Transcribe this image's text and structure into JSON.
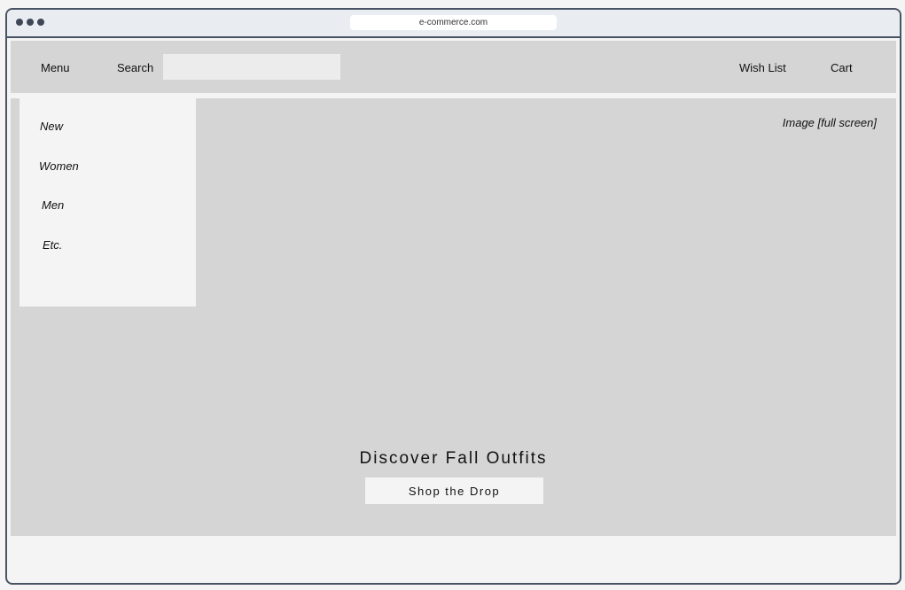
{
  "browser": {
    "url": "e-commerce.com"
  },
  "navbar": {
    "menu_label": "Menu",
    "search_label": "Search",
    "search_value": "",
    "wishlist_label": "Wish List",
    "cart_label": "Cart"
  },
  "menu_dropdown": {
    "items": [
      {
        "label": "New"
      },
      {
        "label": "Women"
      },
      {
        "label": "Men"
      },
      {
        "label": "Etc."
      }
    ]
  },
  "hero": {
    "image_label": "Image [full screen]",
    "title": "Discover Fall Outfits",
    "cta_label": "Shop the Drop"
  }
}
